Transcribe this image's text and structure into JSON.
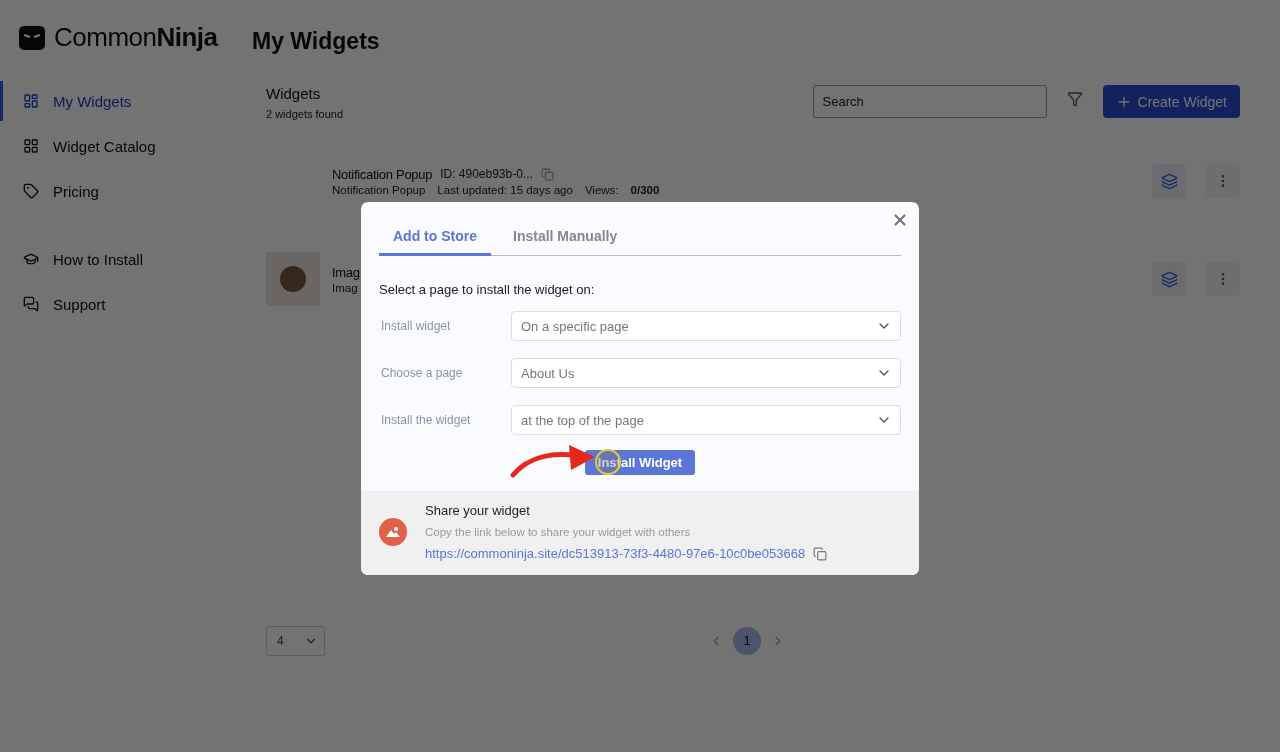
{
  "logo": {
    "text": "Common**Ninja**"
  },
  "sidebar": {
    "items": [
      {
        "label": "My Widgets",
        "selected": true
      },
      {
        "label": "Widget Catalog",
        "selected": false
      },
      {
        "label": "Pricing",
        "selected": false
      }
    ],
    "help_items": [
      {
        "label": "How to Install",
        "selected": false
      },
      {
        "label": "Support",
        "selected": false
      }
    ]
  },
  "page_title": "My Widgets",
  "widgets_header": {
    "title": "Widgets",
    "count": "2 widgets found",
    "search": {
      "placeholder": "Search"
    },
    "create_button": "Create Widget"
  },
  "widgets": [
    {
      "name": "Notification Popup",
      "id": "ID: 490eb93b-0...",
      "type": "Notification Popup",
      "updated": "Last updated: 15 days ago",
      "views_label": "Views:",
      "views": "0/300",
      "thumbnail": false
    },
    {
      "name": "Imag",
      "type": "Imag",
      "thumbnail": true
    }
  ],
  "pagination": {
    "page_size": "4",
    "pages": [
      {
        "label": "1",
        "selected": true
      }
    ]
  },
  "modal": {
    "tabs": [
      {
        "label": "Add to Store",
        "selected": true
      },
      {
        "label": "Install Manually",
        "selected": false
      }
    ],
    "instruction": "Select a page to install the widget on:",
    "fields": [
      {
        "label": "Install widget",
        "value": "On a specific page"
      },
      {
        "label": "Choose a page",
        "value": "About Us"
      },
      {
        "label": "Install the widget",
        "value": "at the top of the page"
      }
    ],
    "install_button": "Install Widget",
    "share": {
      "title": "Share your widget",
      "description": "Copy the link below to share your widget with others",
      "link": "https://commoninja.site/dc513913-73f3-4480-97e6-10c0be053668"
    }
  }
}
